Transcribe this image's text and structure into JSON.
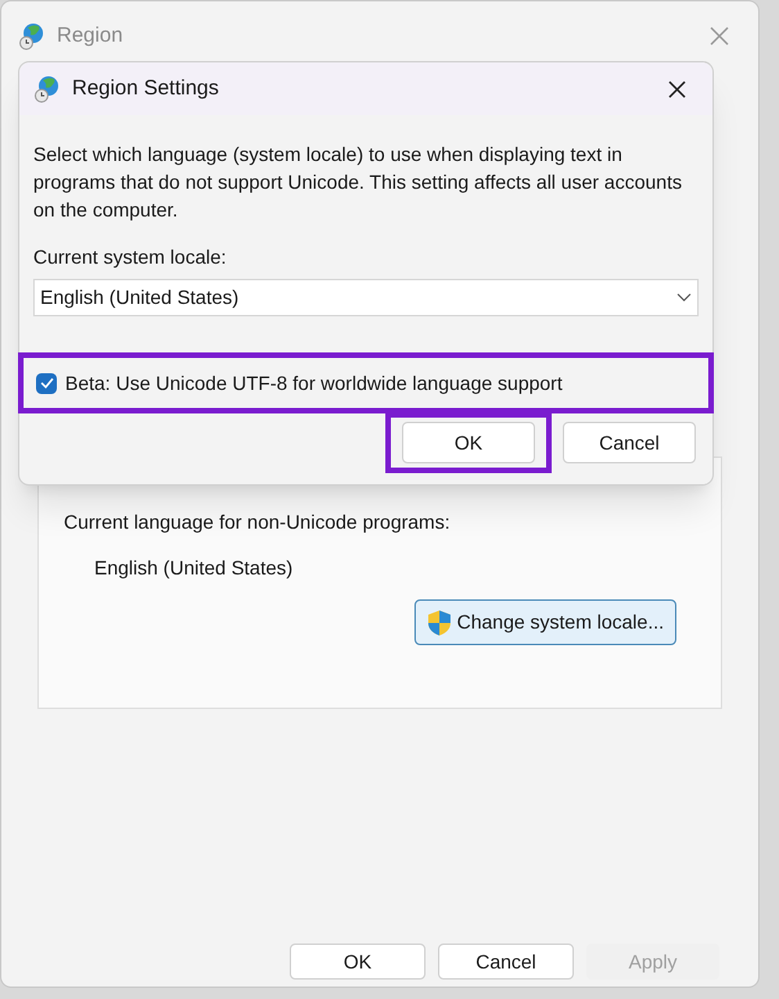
{
  "window": {
    "title": "Region"
  },
  "group": {
    "label": "Current language for non-Unicode programs:",
    "value": "English (United States)",
    "button": "Change system locale..."
  },
  "buttons": [
    {
      "label": "OK",
      "disabled": false
    },
    {
      "label": "Cancel",
      "disabled": false
    },
    {
      "label": "Apply",
      "disabled": true
    }
  ],
  "dialog": {
    "title": "Region Settings",
    "description": "Select which language (system locale) to use when displaying text in programs that do not support Unicode. This setting affects all user accounts on the computer.",
    "locale_label": "Current system locale:",
    "locale_value": "English (United States)",
    "beta": {
      "label": "Beta: Use Unicode UTF-8 for worldwide language support",
      "checked": true,
      "highlighted": true
    },
    "buttons": [
      {
        "label": "OK",
        "highlighted": true
      },
      {
        "label": "Cancel",
        "highlighted": false
      }
    ]
  }
}
